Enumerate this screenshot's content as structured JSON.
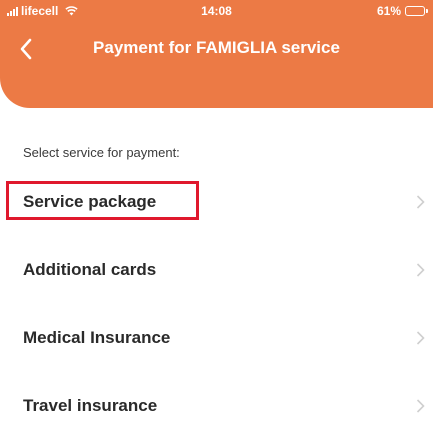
{
  "status_bar": {
    "carrier": "lifecell",
    "time": "14:08",
    "battery": "61%",
    "battery_level": 0.61
  },
  "header": {
    "title": "Payment for FAMIGLIA service",
    "back_icon": "chevron-left-icon"
  },
  "prompt": "Select service for payment:",
  "items": [
    {
      "label": "Service package",
      "highlighted": true
    },
    {
      "label": "Additional cards"
    },
    {
      "label": "Medical Insurance"
    },
    {
      "label": "Travel insurance"
    }
  ],
  "colors": {
    "header_bg": "#ec7a45",
    "highlight_border": "#e0182d",
    "chevron": "#cfcfcf"
  }
}
